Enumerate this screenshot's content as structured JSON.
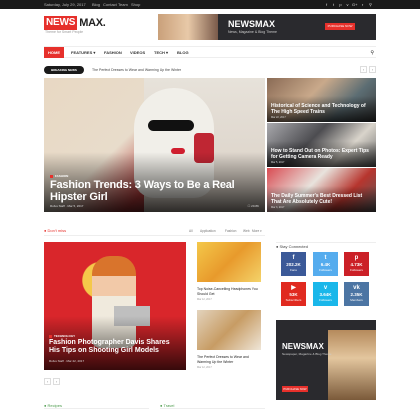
{
  "topbar": {
    "date": "Saturday, July 29, 2017",
    "links": [
      "Blog",
      "Contact",
      "Team",
      "Shop"
    ],
    "social_icons": [
      "facebook-icon",
      "twitter-icon",
      "pinterest-icon",
      "vimeo-icon",
      "google-plus-icon",
      "rss-icon",
      "search-icon"
    ],
    "social_glyphs": [
      "f",
      "t",
      "p",
      "v",
      "G+",
      "r",
      "⚲"
    ]
  },
  "logo": {
    "part1": "NEWS",
    "part2": "MAX.",
    "tagline": "Theme for Smart People"
  },
  "banner": {
    "title": "NEWSMAX",
    "subtitle": "News, Magazine & Blog Theme",
    "button": "PURCHASE NOW"
  },
  "nav": {
    "items": [
      "HOME",
      "FEATURES ▾",
      "FASHION",
      "VIDEOS",
      "TECH ▾",
      "BLOG"
    ],
    "active": "HOME",
    "search_icon": "⚲"
  },
  "ticker": {
    "badge": "BREAKING NEWS",
    "text": "The Perfect Dresses to Wear and Warming Up the Winter",
    "prev": "‹",
    "next": "›"
  },
  "hero": {
    "category": "FASHION",
    "title": "Fashion Trends: 3 Ways to Be a Real Hipster Girl",
    "meta": "Rufus Staff  ·  Mar 5, 2017",
    "comments": "☐ 20.8K"
  },
  "side_posts": [
    {
      "title": "Historical of Science and Technology of The High Speed Trains",
      "meta": "Mar 22, 2017"
    },
    {
      "title": "How to Stand Out on Photos: Expert Tips for Getting Camera Ready",
      "meta": "Mar 5, 2017"
    },
    {
      "title": "The Daily Summer's Best Dressed List That Are Absolutely Cute!",
      "meta": "Mar 3, 2017"
    }
  ],
  "dont_miss": {
    "label": "● Don't miss",
    "tabs": [
      "All",
      "Application",
      "Fashion",
      "Web",
      "More ▾"
    ],
    "main": {
      "category": "TECHNOLOGY",
      "title": "Fashion Photographer Davis Shares His Tips on Shooting Girl Models",
      "meta": "Rufus Staff  ·  Mar 22, 2017"
    },
    "cards": [
      {
        "title": "Top Noise-Cancelling Headphones You Should Get",
        "meta": "Mar 12, 2017"
      },
      {
        "title": "The Perfect Dresses to Wear and Warming Up the Winter",
        "meta": "Mar 12, 2017"
      }
    ],
    "prev": "‹",
    "next": "›"
  },
  "stay_connected": {
    "label": "● Stay Connected",
    "boxes": [
      {
        "icon": "f",
        "count": "202.2K",
        "unit": "Fans",
        "color": "#3b5998"
      },
      {
        "icon": "t",
        "count": "6.4K",
        "unit": "Followers",
        "color": "#55acee"
      },
      {
        "icon": "p",
        "count": "4.73K",
        "unit": "Followers",
        "color": "#cb2027"
      },
      {
        "icon": "▶",
        "count": "53K",
        "unit": "Subscribers",
        "color": "#e02a20"
      },
      {
        "icon": "v",
        "count": "3.64K",
        "unit": "Followers",
        "color": "#1ab7ea"
      },
      {
        "icon": "vk",
        "count": "2.35K",
        "unit": "Members",
        "color": "#4c75a3"
      }
    ]
  },
  "ad2": {
    "title": "NEWSMAX",
    "subtitle": "Newspaper, Magazine & Blog Theme",
    "button": "PURCHASE NOW"
  },
  "bottom_sections": [
    "● Recipes",
    "● Travel"
  ],
  "colors": {
    "accent": "#e6302b",
    "dark": "#1a1a1a",
    "green": "#4a9a4a"
  }
}
